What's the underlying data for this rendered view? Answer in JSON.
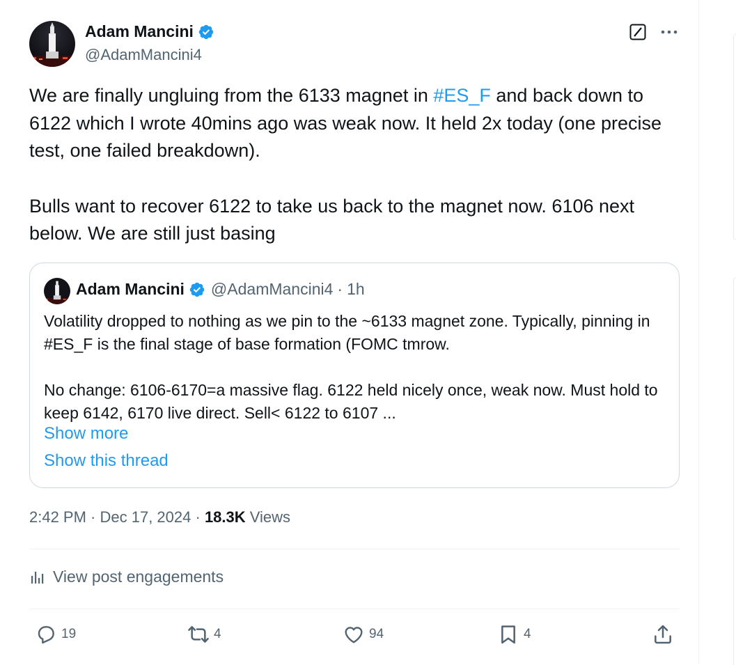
{
  "author": {
    "name": "Adam Mancini",
    "handle": "@AdamMancini4"
  },
  "post": {
    "paragraphs": [
      {
        "before": "We are finally ungluing from the 6133 magnet in ",
        "hashtag": "#ES_F",
        "after": " and back down to 6122 which I wrote 40mins ago was weak now. It held 2x today (one precise test, one failed breakdown)."
      },
      {
        "text": "Bulls want to recover 6122 to take us back to the magnet now. 6106 next below. We are still just basing"
      }
    ]
  },
  "quoted": {
    "name": "Adam Mancini",
    "handle": "@AdamMancini4",
    "separator": "·",
    "time": "1h",
    "paragraph1": "Volatility dropped to nothing as we pin to the ~6133 magnet zone. Typically, pinning in #ES_F is the final stage of base formation (FOMC tmrow.",
    "paragraph2": "No change: 6106-6170=a massive flag. 6122 held nicely once, weak now. Must hold to keep 6142, 6170 live direct. Sell< 6122 to 6107 ...",
    "show_more": "Show more",
    "show_thread": "Show this thread"
  },
  "meta": {
    "time": "2:42 PM",
    "sep1": " · ",
    "date": "Dec 17, 2024",
    "sep2": " · ",
    "views_count": "18.3K",
    "views_label": " Views"
  },
  "engagements_label": "View post engagements",
  "actions": {
    "replies": "19",
    "reposts": "4",
    "likes": "94",
    "bookmarks": "4"
  },
  "icons": [
    "verified-badge-icon",
    "grok-icon",
    "more-icon",
    "analytics-icon",
    "reply-icon",
    "repost-icon",
    "like-icon",
    "bookmark-icon",
    "share-icon"
  ],
  "colors": {
    "accent": "#1d9bf0",
    "text": "#0f1419",
    "secondary": "#536471",
    "border": "#cfd9de"
  }
}
